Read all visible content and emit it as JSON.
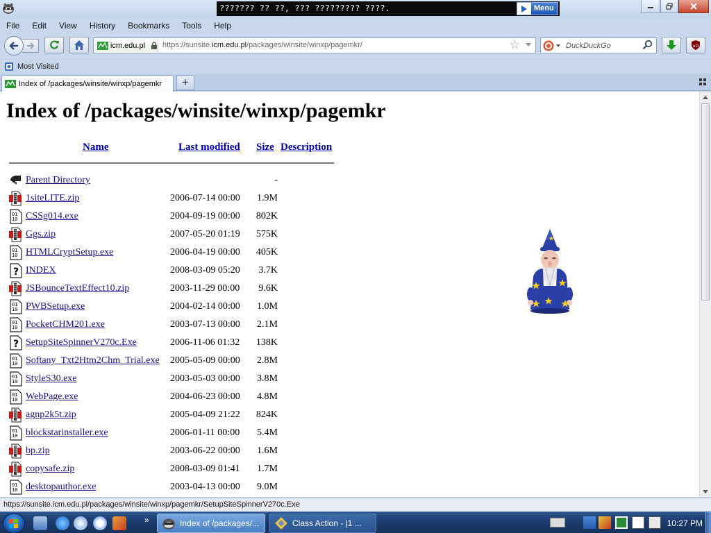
{
  "window": {
    "title": "??????? ?? ??, ??? ????????? ????.",
    "menu_button_label": "Menu"
  },
  "menubar": [
    {
      "label": "File"
    },
    {
      "label": "Edit"
    },
    {
      "label": "View"
    },
    {
      "label": "History"
    },
    {
      "label": "Bookmarks"
    },
    {
      "label": "Tools"
    },
    {
      "label": "Help"
    }
  ],
  "navbar": {
    "site_identity": "icm.edu.pl",
    "url_prefix": "https://sunsite.",
    "url_host": "icm.edu.pl",
    "url_path": "/packages/winsite/winxp/pagemkr/",
    "search_placeholder": "DuckDuckGo"
  },
  "bookmarks": {
    "most_visited": "Most Visited"
  },
  "tab": {
    "title": "Index of /packages/winsite/winxp/pagemkr",
    "new_tab_label": "+"
  },
  "page": {
    "heading": "Index of /packages/winsite/winxp/pagemkr",
    "columns": {
      "name": "Name",
      "last_modified": "Last modified",
      "size": "Size",
      "description": "Description"
    },
    "parent": {
      "name": "Parent Directory",
      "size": "-"
    },
    "files": [
      {
        "name": "1siteLITE.zip",
        "date": "2006-07-14 00:00",
        "size": "1.9M",
        "icon": "zip-icon"
      },
      {
        "name": "CSSg014.exe",
        "date": "2004-09-19 00:00",
        "size": "802K",
        "icon": "binary-icon"
      },
      {
        "name": "Ggs.zip",
        "date": "2007-05-20 01:19",
        "size": "575K",
        "icon": "zip-icon"
      },
      {
        "name": "HTMLCryptSetup.exe",
        "date": "2006-04-19 00:00",
        "size": "405K",
        "icon": "binary-icon"
      },
      {
        "name": "INDEX",
        "date": "2008-03-09 05:20",
        "size": "3.7K",
        "icon": "unknown-icon"
      },
      {
        "name": "JSBounceTextEffect10.zip",
        "date": "2003-11-29 00:00",
        "size": "9.6K",
        "icon": "zip-icon"
      },
      {
        "name": "PWBSetup.exe",
        "date": "2004-02-14 00:00",
        "size": "1.0M",
        "icon": "binary-icon"
      },
      {
        "name": "PocketCHM201.exe",
        "date": "2003-07-13 00:00",
        "size": "2.1M",
        "icon": "binary-icon"
      },
      {
        "name": "SetupSiteSpinnerV270c.Exe",
        "date": "2006-11-06 01:32",
        "size": "138K",
        "icon": "unknown-icon"
      },
      {
        "name": "Softany_Txt2Htm2Chm_Trial.exe",
        "date": "2005-05-09 00:00",
        "size": "2.8M",
        "icon": "binary-icon"
      },
      {
        "name": "StyleS30.exe",
        "date": "2003-05-03 00:00",
        "size": "3.8M",
        "icon": "binary-icon"
      },
      {
        "name": "WebPage.exe",
        "date": "2004-06-23 00:00",
        "size": "4.8M",
        "icon": "binary-icon"
      },
      {
        "name": "agnp2k5t.zip",
        "date": "2005-04-09 21:22",
        "size": "824K",
        "icon": "zip-icon"
      },
      {
        "name": "blockstarinstaller.exe",
        "date": "2006-01-11 00:00",
        "size": "5.4M",
        "icon": "binary-icon"
      },
      {
        "name": "bp.zip",
        "date": "2003-06-22 00:00",
        "size": "1.6M",
        "icon": "zip-icon"
      },
      {
        "name": "copysafe.zip",
        "date": "2008-03-09 01:41",
        "size": "1.7M",
        "icon": "zip-icon"
      },
      {
        "name": "desktopauthor.exe",
        "date": "2003-04-13 00:00",
        "size": "9.0M",
        "icon": "binary-icon"
      }
    ]
  },
  "statusbar": {
    "text": "https://sunsite.icm.edu.pl/packages/winsite/winxp/pagemkr/SetupSiteSpinnerV270c.Exe"
  },
  "taskbar": {
    "expand_label": "»",
    "tasks": [
      {
        "label": "Index of /packages/...",
        "active": true
      },
      {
        "label": "Class Action - |1 ...",
        "active": false
      }
    ],
    "clock": "10:27 PM"
  },
  "colors": {
    "link": "#1a0d8e",
    "header_link": "#0000b0",
    "title_banner": "#0b0b0b",
    "taskbar": "#1a3a6b"
  }
}
